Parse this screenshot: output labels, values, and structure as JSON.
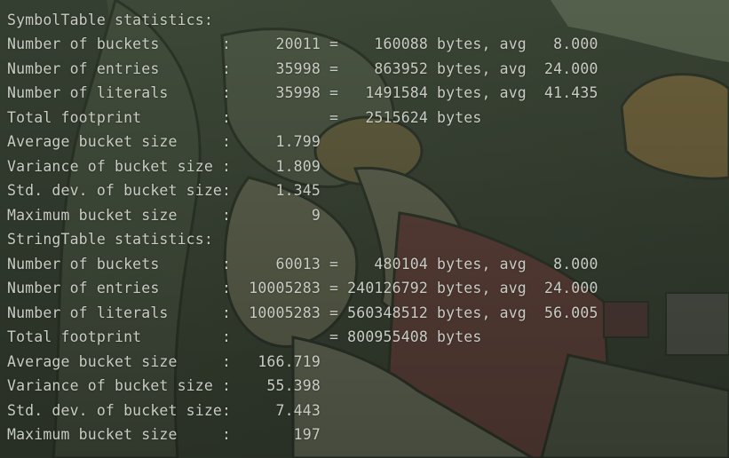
{
  "console": {
    "lines": [
      "SymbolTable statistics:",
      "Number of buckets       :     20011 =    160088 bytes, avg   8.000",
      "Number of entries       :     35998 =    863952 bytes, avg  24.000",
      "Number of literals      :     35998 =   1491584 bytes, avg  41.435",
      "Total footprint         :           =   2515624 bytes",
      "Average bucket size     :     1.799",
      "Variance of bucket size :     1.809",
      "Std. dev. of bucket size:     1.345",
      "Maximum bucket size     :         9",
      "StringTable statistics:",
      "Number of buckets       :     60013 =    480104 bytes, avg   8.000",
      "Number of entries       :  10005283 = 240126792 bytes, avg  24.000",
      "Number of literals      :  10005283 = 560348512 bytes, avg  56.005",
      "Total footprint         :           = 800955408 bytes",
      "Average bucket size     :   166.719",
      "Variance of bucket size :    55.398",
      "Std. dev. of bucket size:     7.443",
      "Maximum bucket size     :       197"
    ]
  },
  "theme": {
    "text_color": "#c9cbc4",
    "background_base": "#3b4536"
  }
}
